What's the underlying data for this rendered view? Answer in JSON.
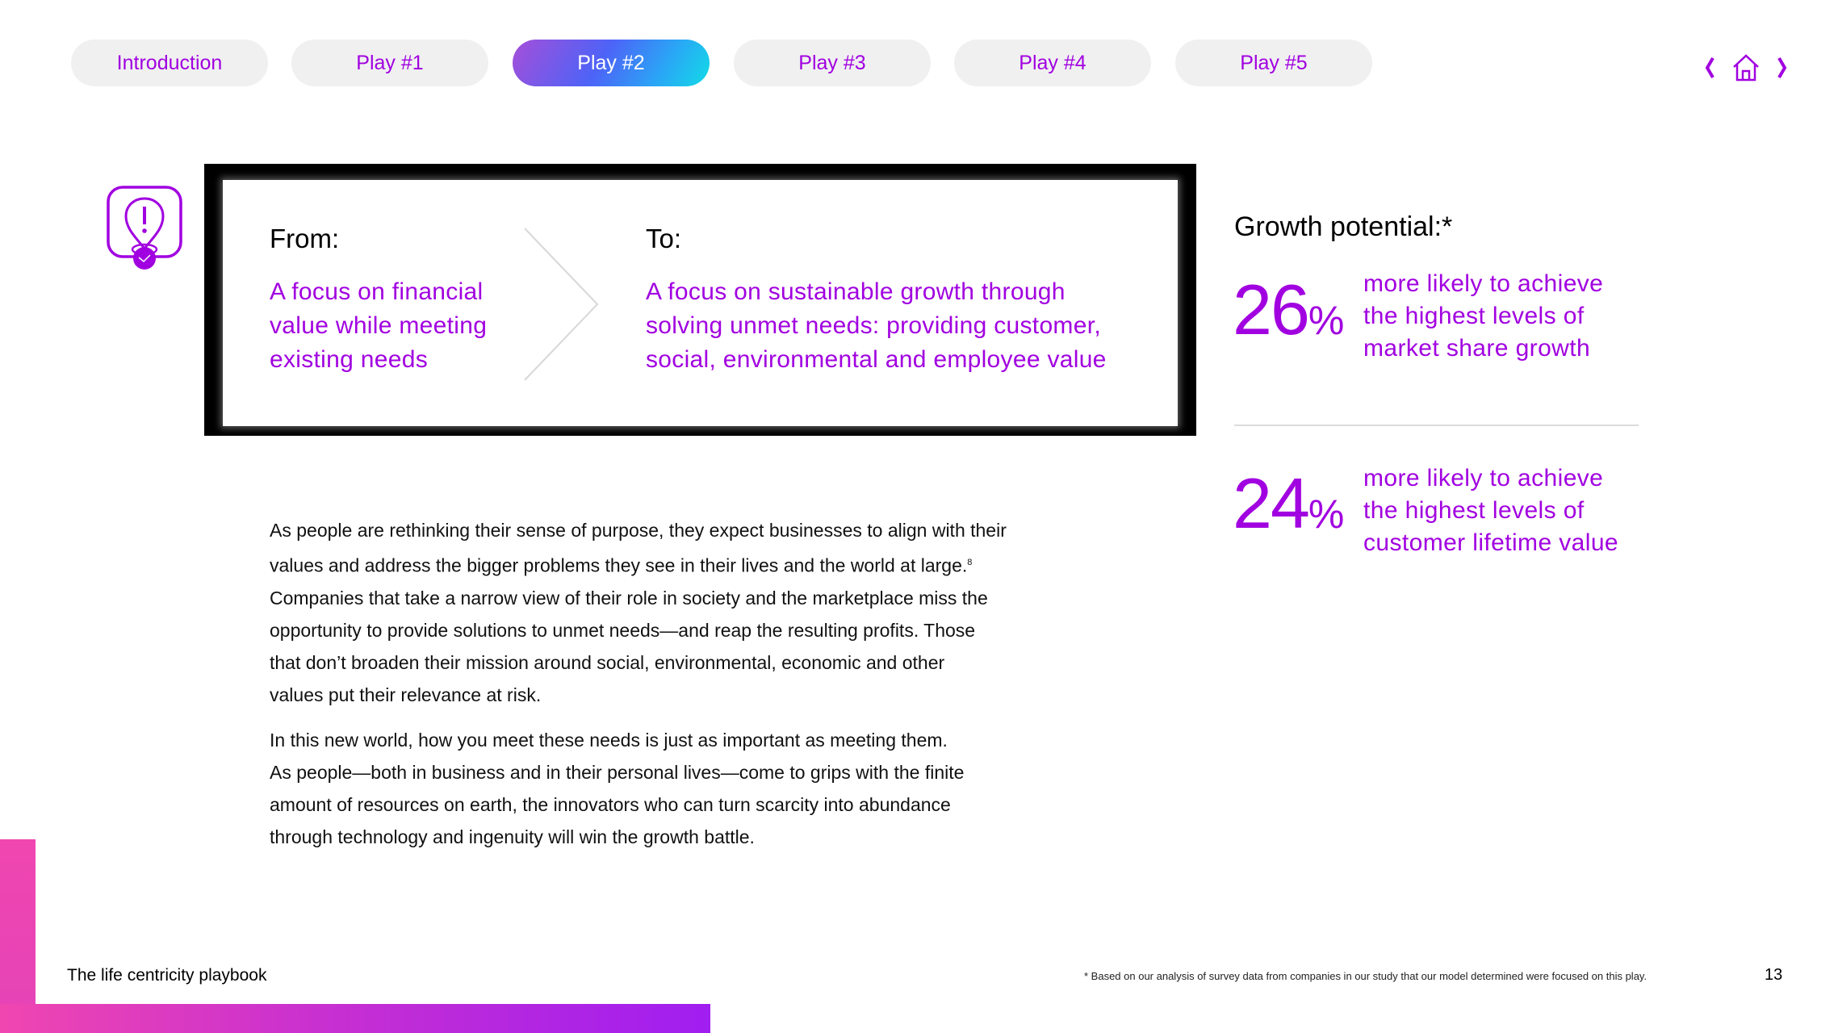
{
  "nav": {
    "tabs": [
      {
        "label": "Introduction",
        "active": false
      },
      {
        "label": "Play #1",
        "active": false
      },
      {
        "label": "Play #2",
        "active": true
      },
      {
        "label": "Play #3",
        "active": false
      },
      {
        "label": "Play #4",
        "active": false
      },
      {
        "label": "Play #5",
        "active": false
      }
    ],
    "prev_icon": "chevron-left-icon",
    "home_icon": "home-icon",
    "next_icon": "chevron-right-icon"
  },
  "play_icon": "location-alert-check-icon",
  "from_to": {
    "from_label": "From:",
    "from_lines": [
      "A focus on financial",
      "value while meeting",
      "existing needs"
    ],
    "to_label": "To:",
    "to_lines": [
      "A focus on sustainable growth through",
      "solving unmet needs: providing customer,",
      "social, environmental and employee value"
    ]
  },
  "growth": {
    "title": "Growth potential:*",
    "stats": [
      {
        "number": "26",
        "unit": "%",
        "lines": [
          "more likely to achieve",
          "the highest levels of",
          "market share growth"
        ]
      },
      {
        "number": "24",
        "unit": "%",
        "lines": [
          "more likely to achieve",
          "the highest levels of",
          "customer lifetime value"
        ]
      }
    ]
  },
  "body": {
    "para1_lines": [
      "As people are rethinking their sense of purpose, they expect businesses to align with their",
      "values and address the bigger problems they see in their lives and the world at large.",
      "Companies that take a narrow view of their role in society and the marketplace miss the",
      "opportunity to provide solutions to unmet needs—and reap the resulting profits. Those",
      "that don’t broaden their mission around social, environmental, economic and other",
      "values put their relevance at risk."
    ],
    "para1_footnote_ref": "8",
    "para2_lines": [
      "In this new world, how you meet these needs is just as important as meeting them.",
      "As people—both in business and in their personal lives—come to grips with the finite",
      "amount of resources on earth, the innovators who can turn scarcity into abundance",
      "through technology and ingenuity will win the growth battle."
    ]
  },
  "footer": {
    "title": "The life centricity playbook",
    "footnote": "* Based on our analysis of survey data from companies in our study that our model determined were focused on this play.",
    "page_number": "13"
  },
  "colors": {
    "accent": "#a100e0",
    "tab_bg": "#f0f0f0",
    "footer_gradient_start": "#f046b0",
    "footer_gradient_end": "#a01ef0"
  }
}
